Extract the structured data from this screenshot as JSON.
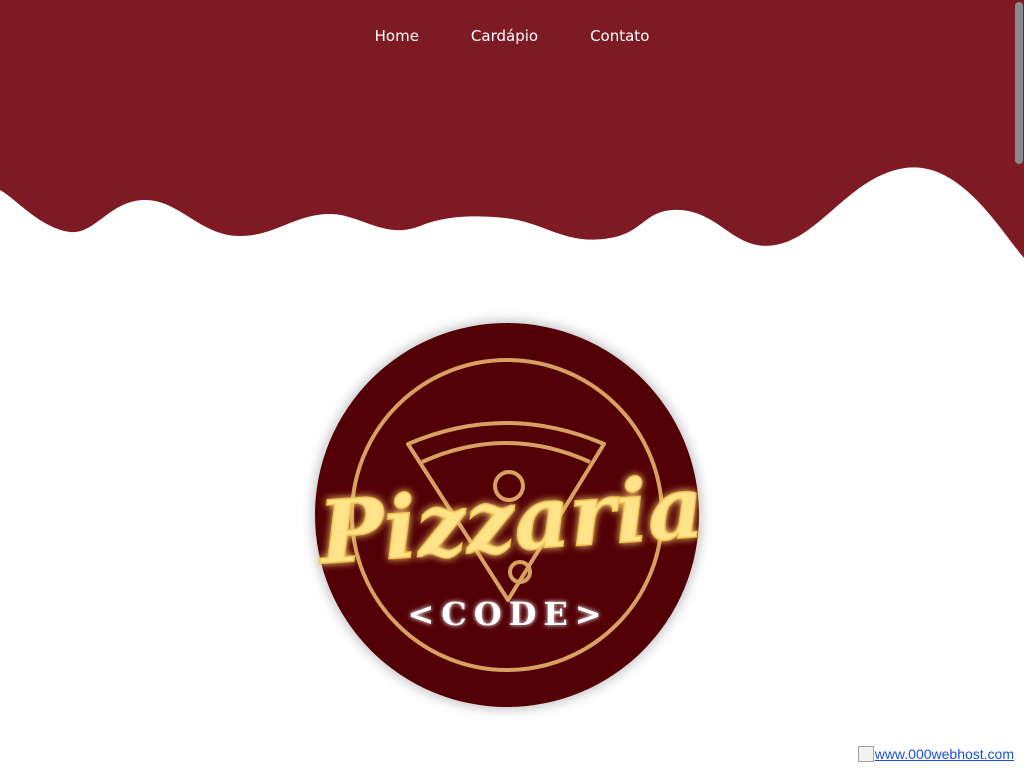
{
  "nav": {
    "items": [
      {
        "label": "Home"
      },
      {
        "label": "Cardápio"
      },
      {
        "label": "Contato"
      }
    ]
  },
  "logo": {
    "script_text": "Pizzaria",
    "sub_text": "<CODE>"
  },
  "footer": {
    "host_link": "www.000webhost.com"
  },
  "colors": {
    "header": "#7e1a24",
    "logo_circle": "#520005",
    "logo_ring": "#d9a160",
    "script_glow": "#ffe38a"
  }
}
